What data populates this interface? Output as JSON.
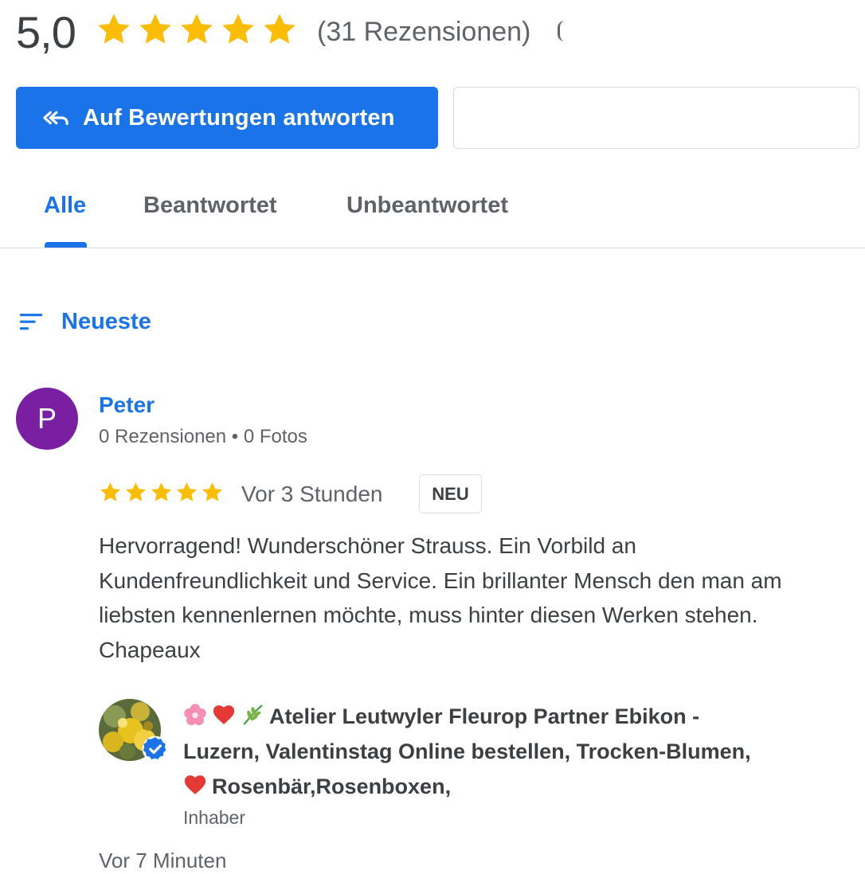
{
  "summary": {
    "rating": "5,0",
    "stars": 5,
    "review_count": "(31 Rezensionen)"
  },
  "actions": {
    "reply_label": "Auf Bewertungen antworten"
  },
  "tabs": [
    {
      "label": "Alle",
      "active": true
    },
    {
      "label": "Beantwortet",
      "active": false
    },
    {
      "label": "Unbeantwortet",
      "active": false
    }
  ],
  "sort": {
    "label": "Neueste"
  },
  "review": {
    "avatar_letter": "P",
    "avatar_color": "#7b1fa2",
    "name": "Peter",
    "meta": "0 Rezensionen • 0 Fotos",
    "stars": 5,
    "time": "Vor 3 Stunden",
    "badge": "NEU",
    "text": "Hervorragend! Wunderschöner Strauss. Ein Vorbild an Kundenfreundlichkeit und Service. Ein brillanter Mensch den man am liebsten kennenlernen möchte, muss hinter diesen Werken stehen. Chapeaux"
  },
  "owner_reply": {
    "name_line1": "Atelier Leutwyler Fleurop Partner Ebikon -",
    "name_line2": "Luzern, Valentinstag Online bestellen, Trocken-Blumen,",
    "name_line3": "Rosenbär,Rosenboxen,",
    "role": "Inhaber",
    "time": "Vor 7 Minuten"
  },
  "colors": {
    "accent": "#1a73e8",
    "star": "#fbbc04",
    "text": "#3c4043",
    "muted": "#5f6368"
  }
}
